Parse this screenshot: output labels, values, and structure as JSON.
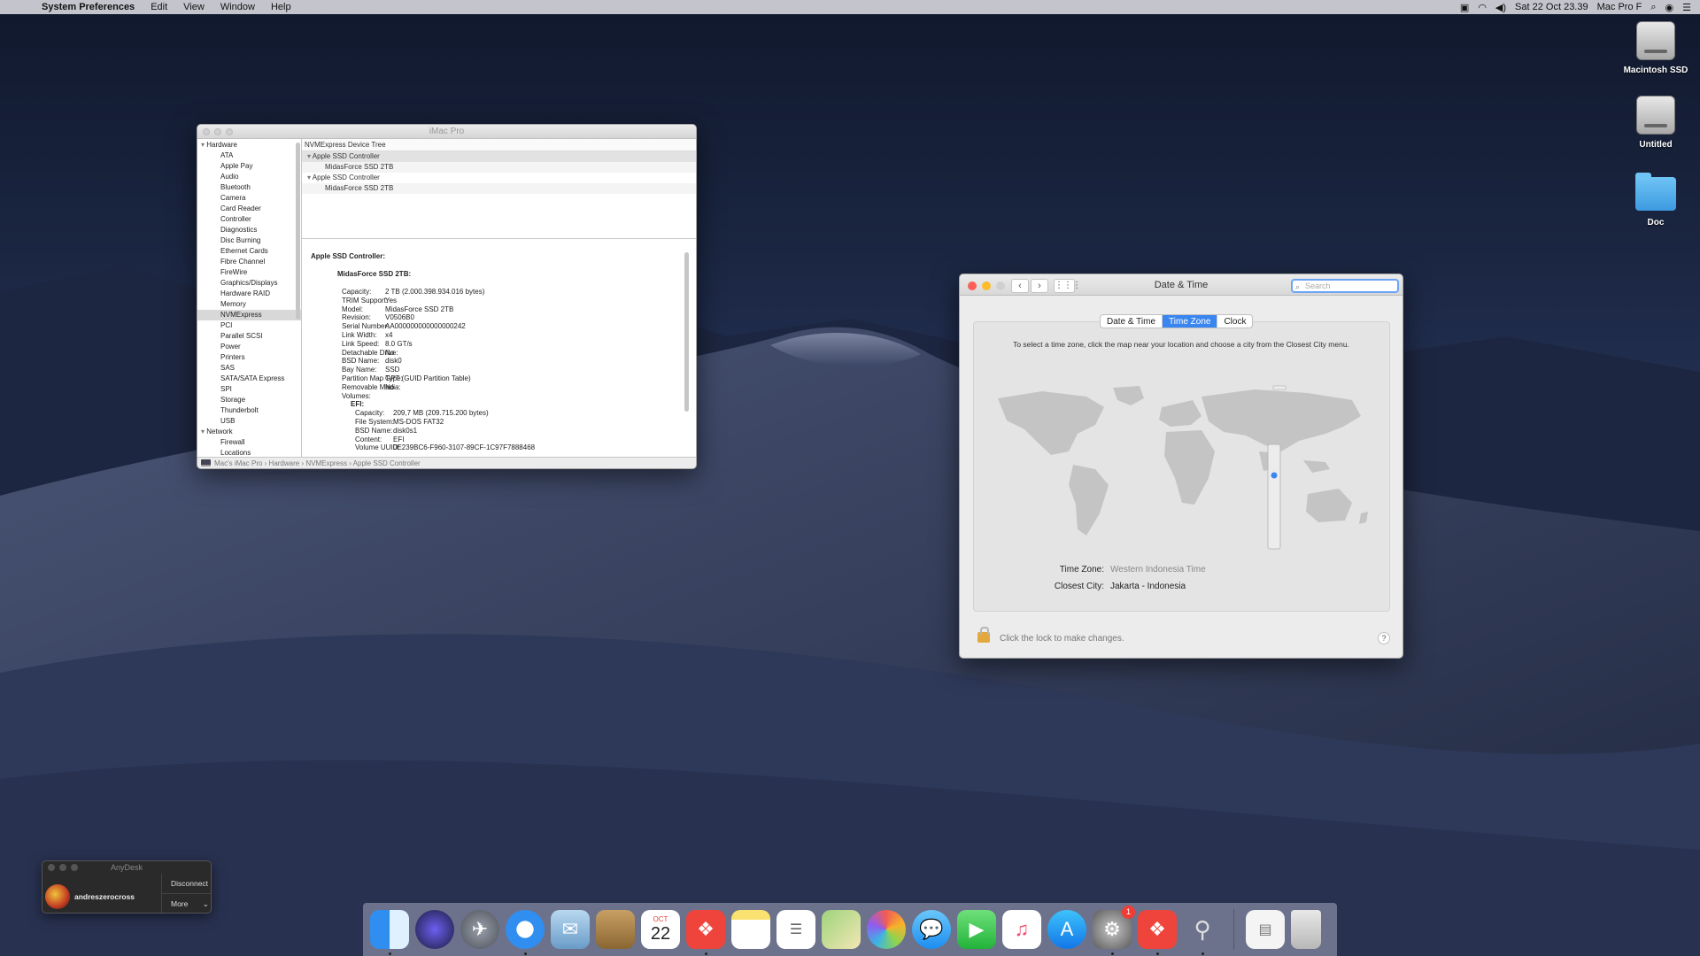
{
  "menubar": {
    "app": "System Preferences",
    "menus": [
      "Edit",
      "View",
      "Window",
      "Help"
    ],
    "clock": "Sat 22 Oct  23.39",
    "computer": "Mac Pro F"
  },
  "desktop": {
    "icons": [
      {
        "label": "Macintosh SSD",
        "icon": "hard-drive-icon"
      },
      {
        "label": "Untitled",
        "icon": "hard-drive-icon"
      },
      {
        "label": "Doc",
        "icon": "folder-icon"
      }
    ]
  },
  "sysinfo": {
    "title": "iMac Pro",
    "sidebar": {
      "hardware_group": "Hardware",
      "hardware_items": [
        "ATA",
        "Apple Pay",
        "Audio",
        "Bluetooth",
        "Camera",
        "Card Reader",
        "Controller",
        "Diagnostics",
        "Disc Burning",
        "Ethernet Cards",
        "Fibre Channel",
        "FireWire",
        "Graphics/Displays",
        "Hardware RAID",
        "Memory",
        "NVMExpress",
        "PCI",
        "Parallel SCSI",
        "Power",
        "Printers",
        "SAS",
        "SATA/SATA Express",
        "SPI",
        "Storage",
        "Thunderbolt",
        "USB"
      ],
      "selected": "NVMExpress",
      "network_group": "Network",
      "network_items": [
        "Firewall",
        "Locations"
      ]
    },
    "tree": {
      "header": "NVMExpress Device Tree",
      "rows": [
        {
          "kind": "ctrl",
          "label": "Apple SSD Controller"
        },
        {
          "kind": "dev",
          "label": "MidasForce SSD 2TB"
        },
        {
          "kind": "ctrl",
          "label": "Apple SSD Controller"
        },
        {
          "kind": "dev",
          "label": "MidasForce SSD 2TB"
        }
      ]
    },
    "detail": {
      "heading": "Apple SSD Controller:",
      "device": "MidasForce SSD 2TB:",
      "props": [
        {
          "k": "Capacity:",
          "v": "2 TB (2.000.398.934.016 bytes)"
        },
        {
          "k": "TRIM Support:",
          "v": "Yes"
        },
        {
          "k": "Model:",
          "v": "MidasForce SSD 2TB"
        },
        {
          "k": "Revision:",
          "v": "V0506B0"
        },
        {
          "k": "Serial Number:",
          "v": "AA000000000000000242"
        },
        {
          "k": "Link Width:",
          "v": "x4"
        },
        {
          "k": "Link Speed:",
          "v": "8.0 GT/s"
        },
        {
          "k": "Detachable Drive:",
          "v": "No"
        },
        {
          "k": "BSD Name:",
          "v": "disk0"
        },
        {
          "k": "Bay Name:",
          "v": "SSD"
        },
        {
          "k": "Partition Map Type:",
          "v": "GPT (GUID Partition Table)"
        },
        {
          "k": "Removable Media:",
          "v": "No"
        },
        {
          "k": "Volumes:",
          "v": ""
        }
      ],
      "volume_name": "EFI:",
      "volume_props": [
        {
          "k": "Capacity:",
          "v": "209,7 MB (209.715.200 bytes)"
        },
        {
          "k": "File System:",
          "v": "MS-DOS FAT32"
        },
        {
          "k": "BSD Name:",
          "v": "disk0s1"
        },
        {
          "k": "Content:",
          "v": "EFI"
        },
        {
          "k": "Volume UUID:",
          "v": "0E239BC6-F960-3107-89CF-1C97F7888468"
        }
      ]
    },
    "breadcrumb": "Mac's iMac Pro  ›  Hardware  ›  NVMExpress  ›  Apple SSD Controller"
  },
  "datetime": {
    "title": "Date & Time",
    "search_placeholder": "Search",
    "tabs": [
      "Date & Time",
      "Time Zone",
      "Clock"
    ],
    "active_tab": "Time Zone",
    "instruction": "To select a time zone, click the map near your location and choose a city from the Closest City menu.",
    "time_zone_label": "Time Zone:",
    "time_zone_value": "Western Indonesia Time",
    "closest_city_label": "Closest City:",
    "closest_city_value": "Jakarta - Indonesia",
    "lock_text": "Click the lock to make changes.",
    "help": "?"
  },
  "anydesk": {
    "title": "AnyDesk",
    "user": "andreszerocross",
    "disconnect": "Disconnect",
    "more": "More"
  },
  "dock": {
    "calendar_month": "OCT",
    "calendar_day": "22",
    "badge_count": "1"
  },
  "colors": {
    "accent": "#3a86f0",
    "red_light": "#fc5f57",
    "yellow_light": "#fdbc2e"
  }
}
